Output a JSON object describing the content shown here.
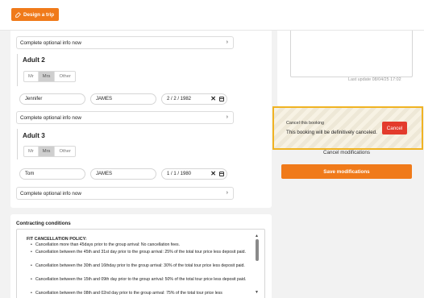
{
  "header": {
    "design_trip_label": "Design a trip"
  },
  "travellers": {
    "optional_info_label": "Complete optional info now",
    "title_options": [
      "Mr",
      "Mrs",
      "Other"
    ],
    "selected_title": "Mrs",
    "adult2": {
      "heading": "Adult 2",
      "first_name": "Jennifer",
      "last_name": "JAMES",
      "dob": "2  /  2  /  1982"
    },
    "adult3": {
      "heading": "Adult 3",
      "first_name": "Tom",
      "last_name": "JAMES",
      "dob": "1  /  1  /  1980"
    }
  },
  "contract": {
    "heading": "Contracting conditions",
    "policy_title": "FIT CANCELLATION POLICY:",
    "items": [
      "Cancellation more than 45days prior to the group arrival: No cancellation fees.",
      "Cancellation between the 45th and 31st day prior to the group arrival: 25% of the total tour price less deposit paid.",
      "Cancellation between the 30th and 16thday prior to the group arrival: 30% of the total tour price less deposit paid.",
      "Cancellation between the 15th and 09th day prior to the group arrival: 50% of the total tour price less deposit paid.",
      "Cancellation between the 08th and 02nd day prior to the group arrival: 75% of the total tour price less"
    ]
  },
  "sidebar": {
    "last_update": "Last update 08/04/25 17:02",
    "cancel_card_title": "Cancel this booking",
    "cancel_card_text": "This booking will be definitively canceled.",
    "cancel_button": "Cancel",
    "cancel_modifications": "Cancel modifications",
    "save_modifications": "Save modifications"
  },
  "colors": {
    "accent": "#f07a1a",
    "danger": "#e33b2c",
    "highlight": "#f0b323"
  }
}
